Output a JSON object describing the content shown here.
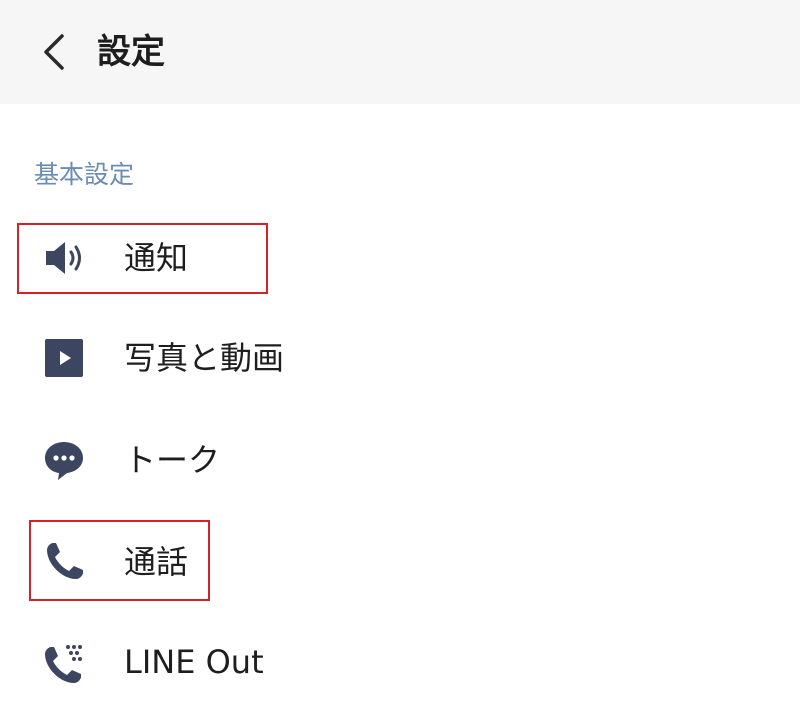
{
  "header": {
    "back_icon": "chevron-left-icon",
    "title": "設定"
  },
  "section": {
    "title": "基本設定"
  },
  "items": [
    {
      "label": "通知",
      "icon": "speaker-icon",
      "highlighted": true
    },
    {
      "label": "写真と動画",
      "icon": "play-icon",
      "highlighted": false
    },
    {
      "label": "トーク",
      "icon": "chat-bubble-icon",
      "highlighted": false
    },
    {
      "label": "通話",
      "icon": "phone-icon",
      "highlighted": true
    },
    {
      "label": "LINE Out",
      "icon": "phone-dialpad-icon",
      "highlighted": false
    }
  ],
  "colors": {
    "header_bg": "#f6f6f6",
    "section_title": "#6a8cb5",
    "icon": "#3d4661",
    "text": "#1e1e1e",
    "highlight_border": "#d6202a"
  }
}
